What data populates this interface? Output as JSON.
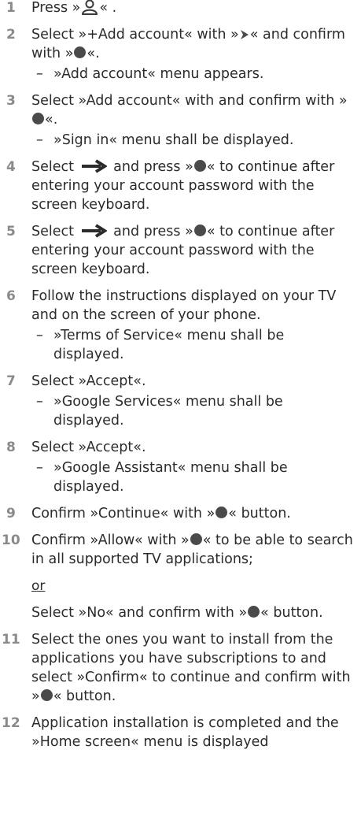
{
  "steps": [
    {
      "number": "1",
      "parts": [
        "Press »",
        "« ."
      ],
      "icon": "person-icon"
    },
    {
      "number": "2",
      "parts": [
        "Select »+Add account«  with »",
        "« and confirm with »",
        "«."
      ],
      "sub": "»Add account« menu appears."
    },
    {
      "number": "3",
      "parts": [
        "Select »Add account« with and confirm with »",
        "«."
      ],
      "sub": "»Sign in« menu shall be displayed."
    },
    {
      "number": "4",
      "parts": [
        "Select ",
        " and press »",
        "« to continue after entering your account password with the screen keyboard."
      ]
    },
    {
      "number": "5",
      "parts": [
        "Select ",
        " and press »",
        "« to continue after entering your account password with the screen keyboard."
      ]
    },
    {
      "number": "6",
      "text": "Follow the instructions displayed on your TV and on the screen of your phone.",
      "sub": "»Terms of Service« menu shall be displayed."
    },
    {
      "number": "7",
      "text": "Select »Accept«.",
      "sub": "»Google Services« menu shall be displayed."
    },
    {
      "number": "8",
      "text": "Select »Accept«.",
      "sub": "»Google Assistant« menu shall be displayed."
    },
    {
      "number": "9",
      "parts": [
        "Confirm »Continue« with »",
        "« button."
      ]
    },
    {
      "number": "10",
      "parts": [
        "Confirm »Allow« with »",
        "« to be able to search in all supported TV applications;"
      ],
      "or": "or",
      "alt_parts": [
        "Select »No« and confirm with »",
        "« button."
      ]
    },
    {
      "number": "11",
      "parts": [
        "Select the ones you want to install from the applications you have subscriptions to and select »Confirm« to continue and confirm with »",
        "« button."
      ]
    },
    {
      "number": "12",
      "text": "Application installation is completed and the »Home screen« menu is displayed"
    }
  ],
  "colors": {
    "text": "#2b2b2b",
    "step_number": "#8a8a8a",
    "ok_button_dot": "#4a4a4a"
  }
}
